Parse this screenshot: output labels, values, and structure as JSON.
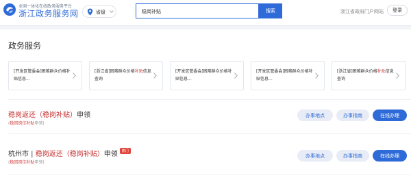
{
  "header": {
    "brand_sub": "全国一体化在线政务服务平台",
    "brand_title": "浙江政务服务网",
    "location": "省级",
    "search_value": "稳岗补贴",
    "search_button": "搜索",
    "portal_link": "浙江省政府门户网站",
    "login": "登录"
  },
  "section_title": "政务服务",
  "cards": [
    {
      "prefix": "[开发区管委会]困难群众价格补贴信息...",
      "highlight": ""
    },
    {
      "prefix": "[浙江省]困难群众价格",
      "highlight": "补贴",
      "suffix": "信息查询"
    },
    {
      "prefix": "[开发区管委会]困难群众价格补贴信息...",
      "highlight": ""
    },
    {
      "prefix": "[开发区管委会]困难群众价格补贴信息...",
      "highlight": ""
    },
    {
      "prefix": "[浙江省]困难群众价格",
      "highlight": "补贴",
      "suffix": "信息查询"
    }
  ],
  "results": [
    {
      "title_pre": "",
      "title_hl1": "稳岗返还（",
      "title_hl2": "稳岗补贴",
      "title_hl3": "）",
      "title_post": "申领",
      "sub_pre": "(",
      "sub_hl": "稳岗岗位补贴",
      "sub_post": "申领)",
      "hot": "",
      "btn_location": "办事地点",
      "btn_guide": "办事指南",
      "btn_online": "在线办理"
    },
    {
      "title_pre": "杭州市 | ",
      "title_hl1": "稳岗返还（",
      "title_hl2": "稳岗补贴",
      "title_hl3": "）",
      "title_post": "申领",
      "sub_pre": "(",
      "sub_hl": "稳岗岗位补贴",
      "sub_post": "申领)",
      "hot": "热门",
      "btn_location": "办事地点",
      "btn_guide": "办事指南",
      "btn_online": "在线办理"
    }
  ],
  "colors": {
    "accent": "#2f6bd8",
    "highlight": "#c62f2f"
  }
}
